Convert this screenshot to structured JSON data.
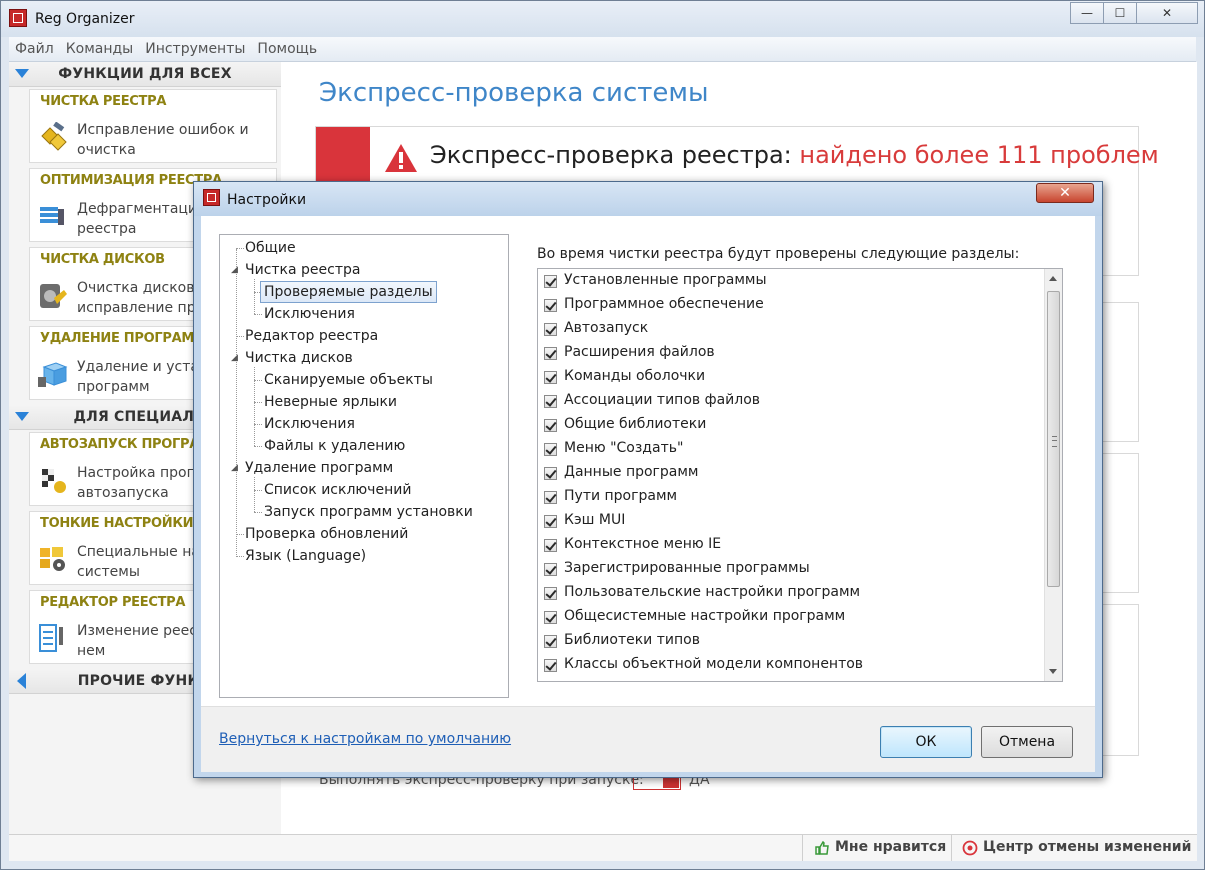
{
  "app": {
    "title": "Reg Organizer"
  },
  "window_controls": {
    "minimize": "—",
    "maximize": "☐",
    "close": "✕"
  },
  "menu": [
    "Файл",
    "Команды",
    "Инструменты",
    "Помощь"
  ],
  "sidebar": {
    "section1": "ФУНКЦИИ ДЛЯ ВСЕХ",
    "section2": "ДЛЯ СПЕЦИАЛИС",
    "section3": "ПРОЧИЕ ФУНКЦ",
    "cards": [
      {
        "category": "ЧИСТКА РЕЕСТРА",
        "desc": "Исправление ошибок и очистка",
        "icon": "registry-repair-icon"
      },
      {
        "category": "ОПТИМИЗАЦИЯ РЕЕСТРА",
        "desc": "Дефрагментация реестра",
        "icon": "defrag-icon"
      },
      {
        "category": "ЧИСТКА ДИСКОВ",
        "desc": "Очистка дисков и исправление про",
        "icon": "disk-cleanup-icon"
      },
      {
        "category": "УДАЛЕНИЕ ПРОГРАММ",
        "desc": "Удаление и устан программ",
        "icon": "uninstall-icon"
      },
      {
        "category": "АВТОЗАПУСК ПРОГРАММ",
        "desc": "Настройка прогр автозапуска",
        "icon": "autorun-icon"
      },
      {
        "category": "ТОНКИЕ НАСТРОЙКИ",
        "desc": "Специальные на системы",
        "icon": "tweaks-icon"
      },
      {
        "category": "РЕДАКТОР РЕЕСТРА",
        "desc": "Изменение реес поиск в нем",
        "icon": "registry-editor-icon"
      }
    ]
  },
  "main": {
    "title": "Экспресс-проверка системы",
    "express_label": "Экспресс-проверка реестра: ",
    "express_result": "найдено более 111 проблем",
    "run_on_start": "Выполнять экспресс-проверку при запуске:",
    "run_on_start_value": "ДА"
  },
  "statusbar": {
    "like": "Мне нравится",
    "undo_center": "Центр отмены изменений"
  },
  "dialog": {
    "title": "Настройки",
    "close": "✕",
    "tree": [
      "Общие",
      "Чистка реестра",
      "Проверяемые разделы",
      "Исключения",
      "Редактор реестра",
      "Чистка дисков",
      "Сканируемые объекты",
      "Неверные ярлыки",
      "Исключения",
      "Файлы к удалению",
      "Удаление программ",
      "Список исключений",
      "Запуск программ установки",
      "Проверка обновлений",
      "Язык (Language)"
    ],
    "sections_label": "Во время чистки реестра будут проверены следующие разделы:",
    "sections": [
      "Установленные программы",
      "Программное обеспечение",
      "Автозапуск",
      "Расширения файлов",
      "Команды оболочки",
      "Ассоциации типов файлов",
      "Общие библиотеки",
      "Меню \"Создать\"",
      "Данные программ",
      "Пути программ",
      "Кэш MUI",
      "Контекстное меню IE",
      "Зарегистрированные программы",
      "Пользовательские настройки программ",
      "Общесистемные настройки программ",
      "Библиотеки типов",
      "Классы объектной модели компонентов"
    ],
    "reset_link": "Вернуться к настройкам по умолчанию",
    "ok": "ОК",
    "cancel": "Отмена"
  }
}
